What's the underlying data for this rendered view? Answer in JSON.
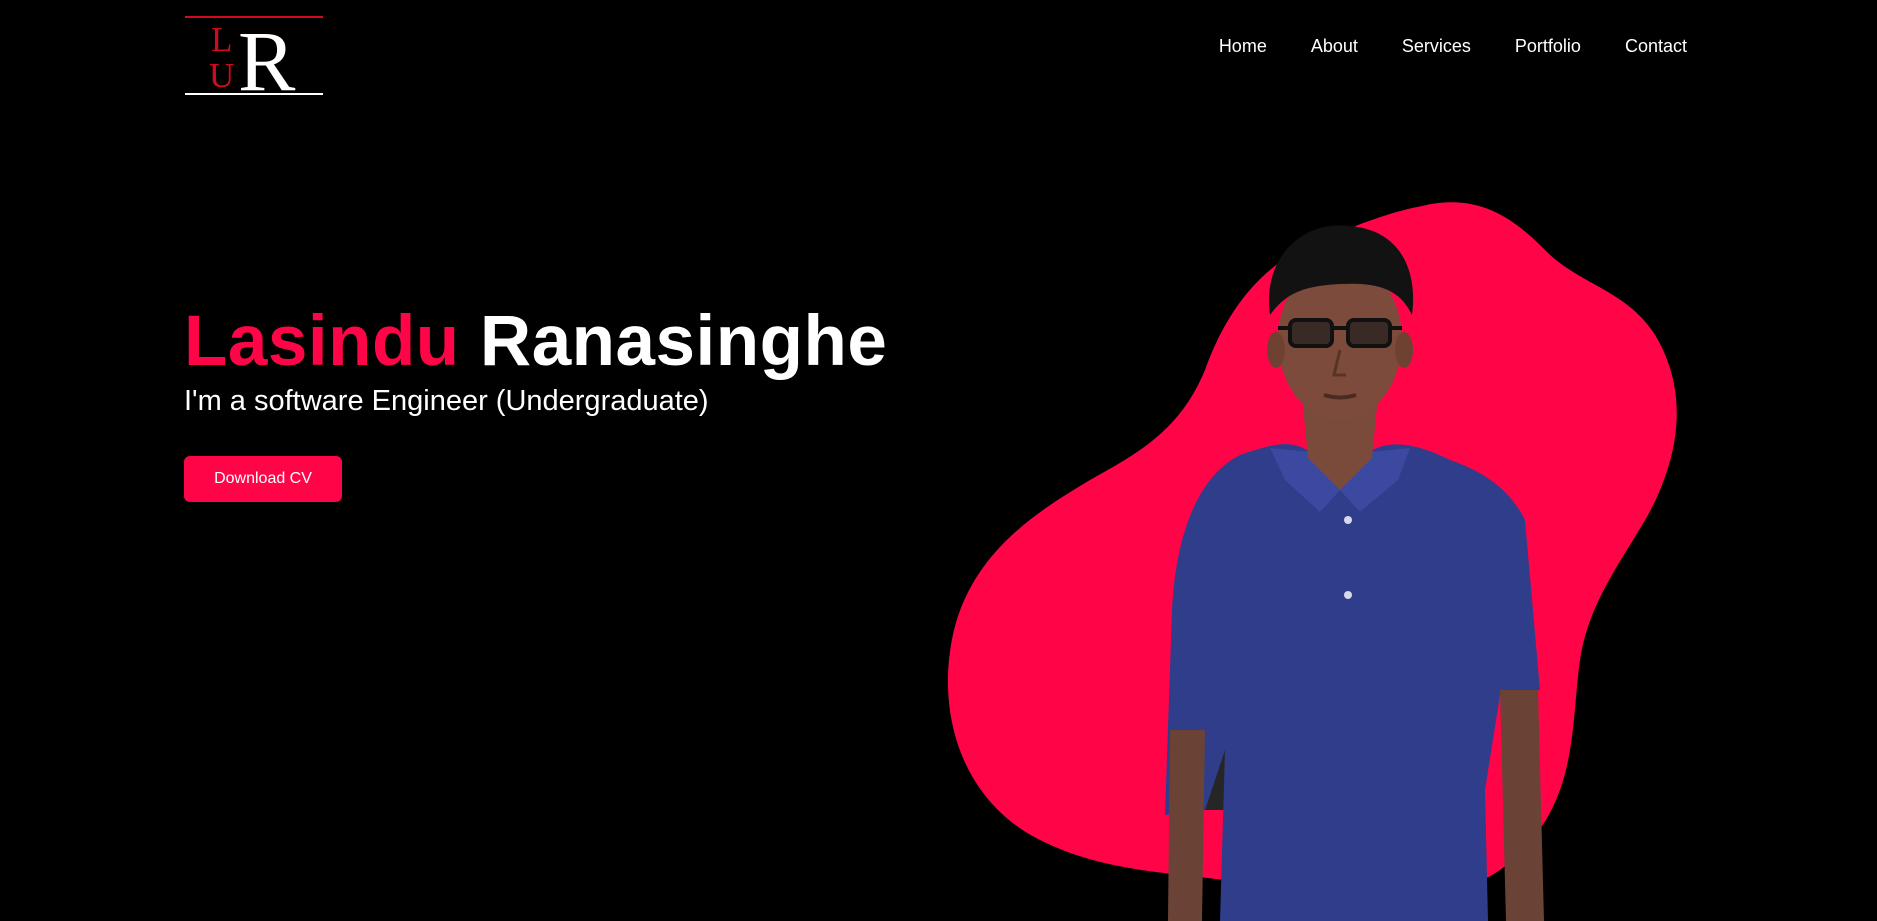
{
  "logo": {
    "letter_l": "L",
    "letter_u": "U",
    "letter_r": "R"
  },
  "nav": {
    "items": [
      "Home",
      "About",
      "Services",
      "Portfolio",
      "Contact"
    ]
  },
  "hero": {
    "first_name": "Lasindu",
    "last_name": "Ranasinghe",
    "subtitle": "I'm a software Engineer (Undergraduate)",
    "cv_button": "Download CV"
  },
  "colors": {
    "accent": "#ff0548",
    "logo_red": "#d10b1f",
    "background": "#000000",
    "text": "#ffffff",
    "shirt": "#2f3d8a"
  }
}
